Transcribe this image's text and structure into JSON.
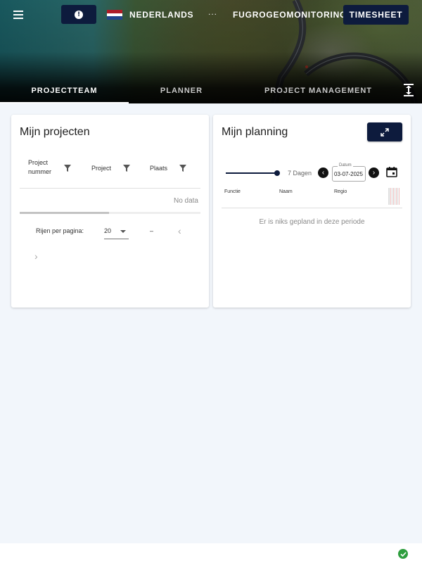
{
  "header": {
    "language_label": "NEDERLANDS",
    "more_label": "...",
    "company_label": "FUGROGEOMONITORING",
    "timesheet_label": "TIMESHEET",
    "flag_colors": [
      "#ae1c28",
      "#ffffff",
      "#21468b"
    ]
  },
  "tabs": [
    {
      "label": "PROJECTTEAM",
      "active": true
    },
    {
      "label": "PLANNER",
      "active": false
    },
    {
      "label": "PROJECT MANAGEMENT",
      "active": false
    }
  ],
  "projects": {
    "title": "Mijn projecten",
    "columns": [
      {
        "label": "Project nummer",
        "icon": "filter-icon"
      },
      {
        "label": "Project",
        "icon": "filter-icon"
      },
      {
        "label": "Plaats",
        "icon": "filter-icon"
      }
    ],
    "empty_text": "No data",
    "rows_per_page_label": "Rijen per pagina:",
    "rows_per_page_value": "20",
    "range_text": "–"
  },
  "planning": {
    "title": "Mijn planning",
    "days_label": "7 Dagen",
    "date_legend": "Datum",
    "date_value": "03-07-2025",
    "columns": [
      "Functie",
      "Naam",
      "Regio"
    ],
    "empty_text": "Er is niks gepland in deze periode"
  },
  "colors": {
    "navy": "#0d1b3d",
    "background": "#f2f6fb",
    "status_ok": "#2e9e3e"
  }
}
